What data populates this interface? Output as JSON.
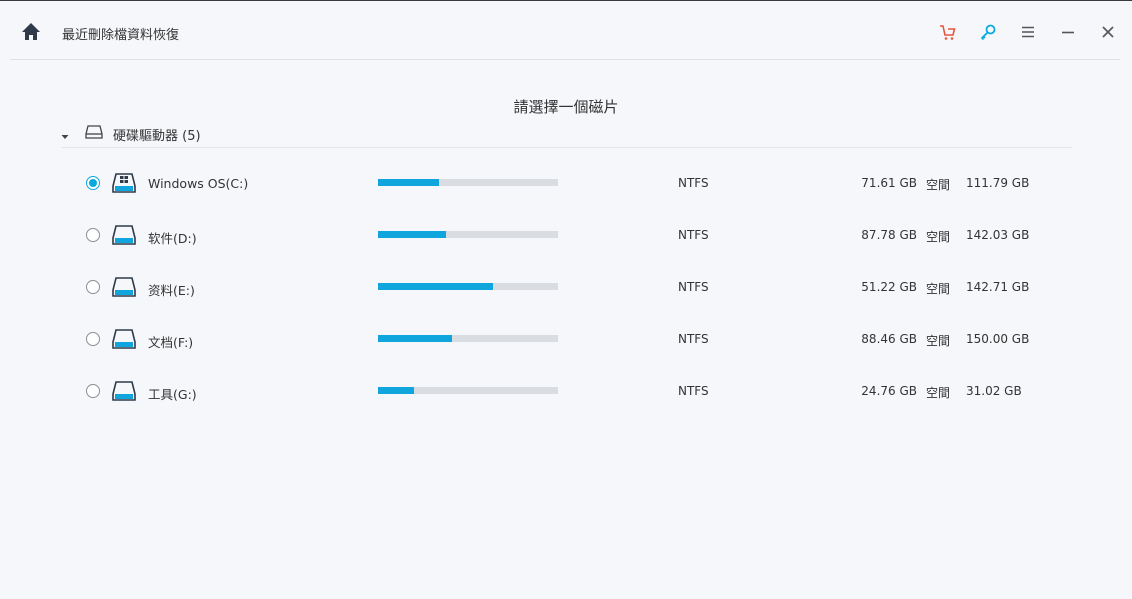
{
  "app": {
    "title": "最近刪除檔資料恢復"
  },
  "icons": {
    "home": "home-icon",
    "cart": "cart-icon",
    "key": "key-icon",
    "menu": "menu-icon",
    "minimize": "minimize-icon",
    "close": "close-icon"
  },
  "colors": {
    "accent": "#0aa8e0",
    "cart": "#e8553c",
    "background": "#f5f7fa"
  },
  "main": {
    "title": "請選擇一個磁片",
    "group": {
      "label": "硬碟驅動器 (5)",
      "expanded": true
    },
    "drives": [
      {
        "name": "Windows OS(C:)",
        "fs": "NTFS",
        "free": "71.61 GB",
        "free_label": "空間",
        "total": "111.79 GB",
        "used_fraction": 0.34,
        "selected": true,
        "type": "system"
      },
      {
        "name": "软件(D:)",
        "fs": "NTFS",
        "free": "87.78 GB",
        "free_label": "空間",
        "total": "142.03 GB",
        "used_fraction": 0.38,
        "selected": false,
        "type": "disk"
      },
      {
        "name": "资料(E:)",
        "fs": "NTFS",
        "free": "51.22 GB",
        "free_label": "空間",
        "total": "142.71 GB",
        "used_fraction": 0.64,
        "selected": false,
        "type": "disk"
      },
      {
        "name": "文档(F:)",
        "fs": "NTFS",
        "free": "88.46 GB",
        "free_label": "空間",
        "total": "150.00 GB",
        "used_fraction": 0.41,
        "selected": false,
        "type": "disk"
      },
      {
        "name": "工具(G:)",
        "fs": "NTFS",
        "free": "24.76 GB",
        "free_label": "空間",
        "total": "31.02 GB",
        "used_fraction": 0.2,
        "selected": false,
        "type": "disk"
      }
    ]
  }
}
